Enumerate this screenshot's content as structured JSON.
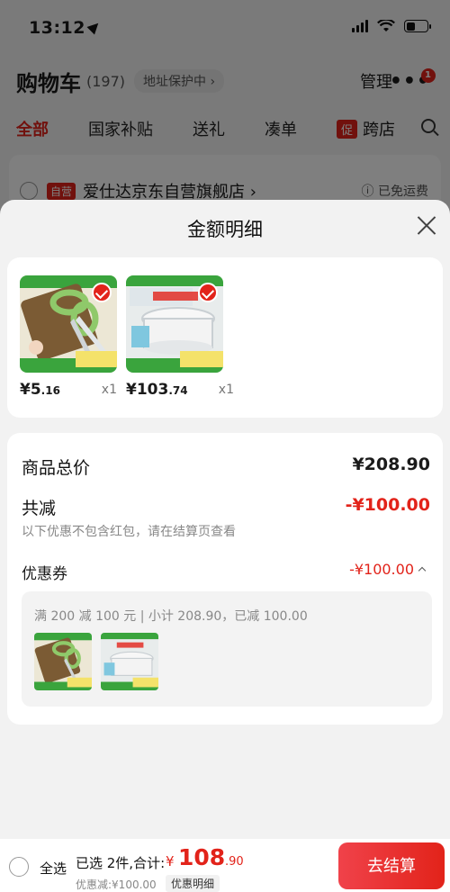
{
  "status_bar": {
    "time": "13:12"
  },
  "cart": {
    "title": "购物车",
    "count": "(197)",
    "address_protect": "地址保护中 ›",
    "manage": "管理",
    "more": "•••",
    "badge": "1",
    "tabs": [
      "全部",
      "国家补贴",
      "送礼",
      "凑单"
    ],
    "promo_tab_tag": "促",
    "promo_tab_label": "跨店",
    "store": {
      "tag": "自营",
      "name": "爱仕达京东自营旗舰店 ›",
      "shipping": "ⓘ 已免运费"
    }
  },
  "sheet": {
    "title": "金额明细",
    "products": [
      {
        "name": "scissors",
        "price_int": "¥5",
        "price_dec": ".16",
        "qty": "x1"
      },
      {
        "name": "casserole",
        "price_int": "¥103",
        "price_dec": ".74",
        "qty": "x1"
      }
    ],
    "summary": {
      "goods_total_label": "商品总价",
      "goods_total_value": "¥208.90",
      "reduction_label": "共减",
      "reduction_value": "-¥100.00",
      "note": "以下优惠不包含红包，请在结算页查看",
      "coupon_label": "优惠券",
      "coupon_value": "-¥100.00",
      "coupon_detail": "满 200 减 100 元 | 小计 208.90，已减 100.00"
    }
  },
  "bottom_bar": {
    "select_all": "全选",
    "selected_info": "已选 2件,合计:",
    "total_yen": "¥",
    "total_int": "108",
    "total_dec": ".90",
    "discount_line": "优惠减:¥100.00",
    "detail_tag": "优惠明细",
    "checkout": "去结算"
  },
  "colors": {
    "accent": "#e2231a",
    "product_green": "#3aa43d"
  }
}
